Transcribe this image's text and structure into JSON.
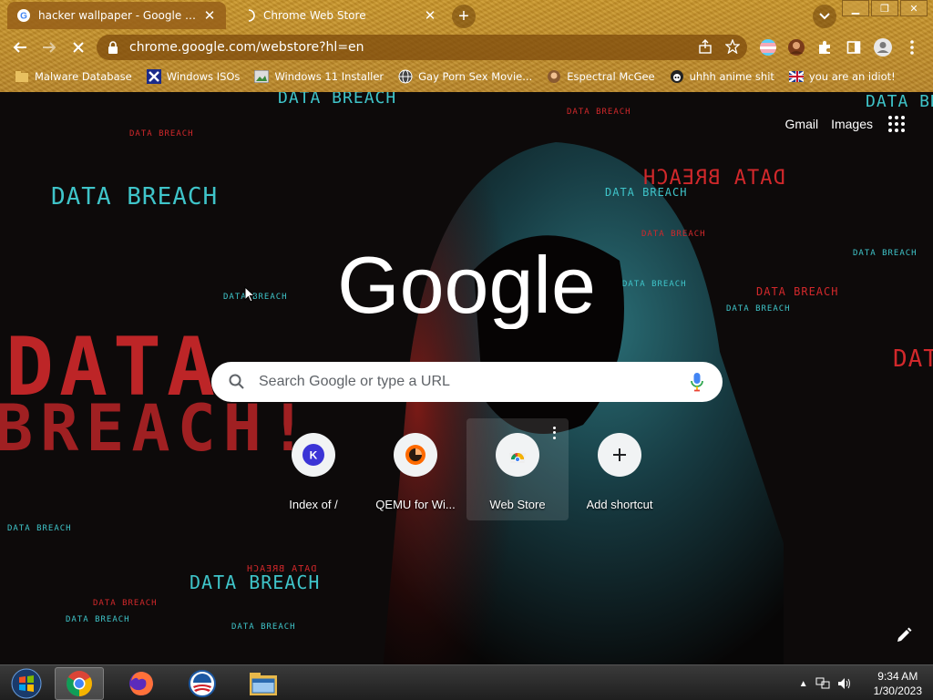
{
  "browser": {
    "tabs": [
      {
        "title": "hacker wallpaper - Google Search",
        "active": true,
        "icon": "google-g-icon"
      },
      {
        "title": "Chrome Web Store",
        "active": false,
        "icon": "loading-spinner-icon"
      }
    ],
    "address_url": "chrome.google.com/webstore?hl=en",
    "bookmarks": [
      {
        "label": "Malware Database",
        "icon": "folder-icon"
      },
      {
        "label": "Windows ISOs",
        "icon": "x-logo-icon"
      },
      {
        "label": "Windows 11 Installer",
        "icon": "image-icon"
      },
      {
        "label": "Gay Porn Sex Movie...",
        "icon": "globe-icon"
      },
      {
        "label": "Espectral McGee",
        "icon": "avatar-icon"
      },
      {
        "label": "uhhh anime shit",
        "icon": "anime-avatar-icon"
      },
      {
        "label": "you are an idiot!",
        "icon": "flag-icon"
      }
    ],
    "theme_color": "#c9962b"
  },
  "ntp": {
    "top_links": {
      "gmail": "Gmail",
      "images": "Images"
    },
    "logo_text": "Google",
    "search_placeholder": "Search Google or type a URL",
    "shortcuts": [
      {
        "label": "Index of /",
        "icon": "k-letter-icon"
      },
      {
        "label": "QEMU for Wi...",
        "icon": "qemu-icon"
      },
      {
        "label": "Web Store",
        "icon": "chrome-web-store-icon"
      },
      {
        "label": "Add shortcut",
        "icon": "plus-icon"
      }
    ],
    "wallpaper_text": {
      "big_red": "DATA",
      "big_red_2": "BREACH!",
      "cyan_large": "DATA BREACH",
      "small": "DATA BREACH"
    }
  },
  "taskbar": {
    "pinned": [
      "windows-start-icon",
      "chrome-icon",
      "firefox-icon",
      "obama-logo-icon",
      "file-explorer-icon"
    ],
    "time": "9:34 AM",
    "date": "1/30/2023"
  }
}
